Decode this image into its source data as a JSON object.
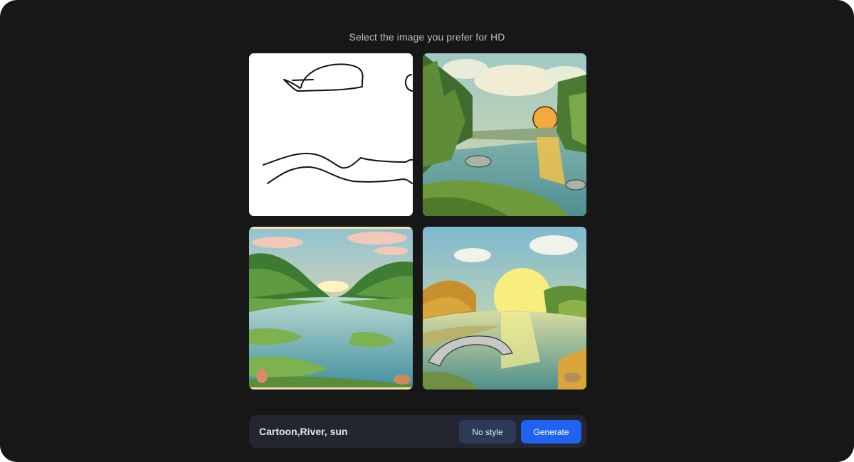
{
  "header": {
    "title": "Select the image you prefer for HD"
  },
  "images": [
    {
      "kind": "sketch",
      "icon": "sketch-image"
    },
    {
      "kind": "generated",
      "icon": "landscape-image"
    },
    {
      "kind": "generated",
      "icon": "landscape-image"
    },
    {
      "kind": "generated",
      "icon": "landscape-image"
    }
  ],
  "prompt_bar": {
    "prompt_text": "Cartoon,River, sun",
    "style_button_label": "No style",
    "generate_button_label": "Generate"
  },
  "colors": {
    "background": "#171717",
    "bar": "#232630",
    "style_button": "#2c3a57",
    "generate_button": "#1f63f1"
  }
}
